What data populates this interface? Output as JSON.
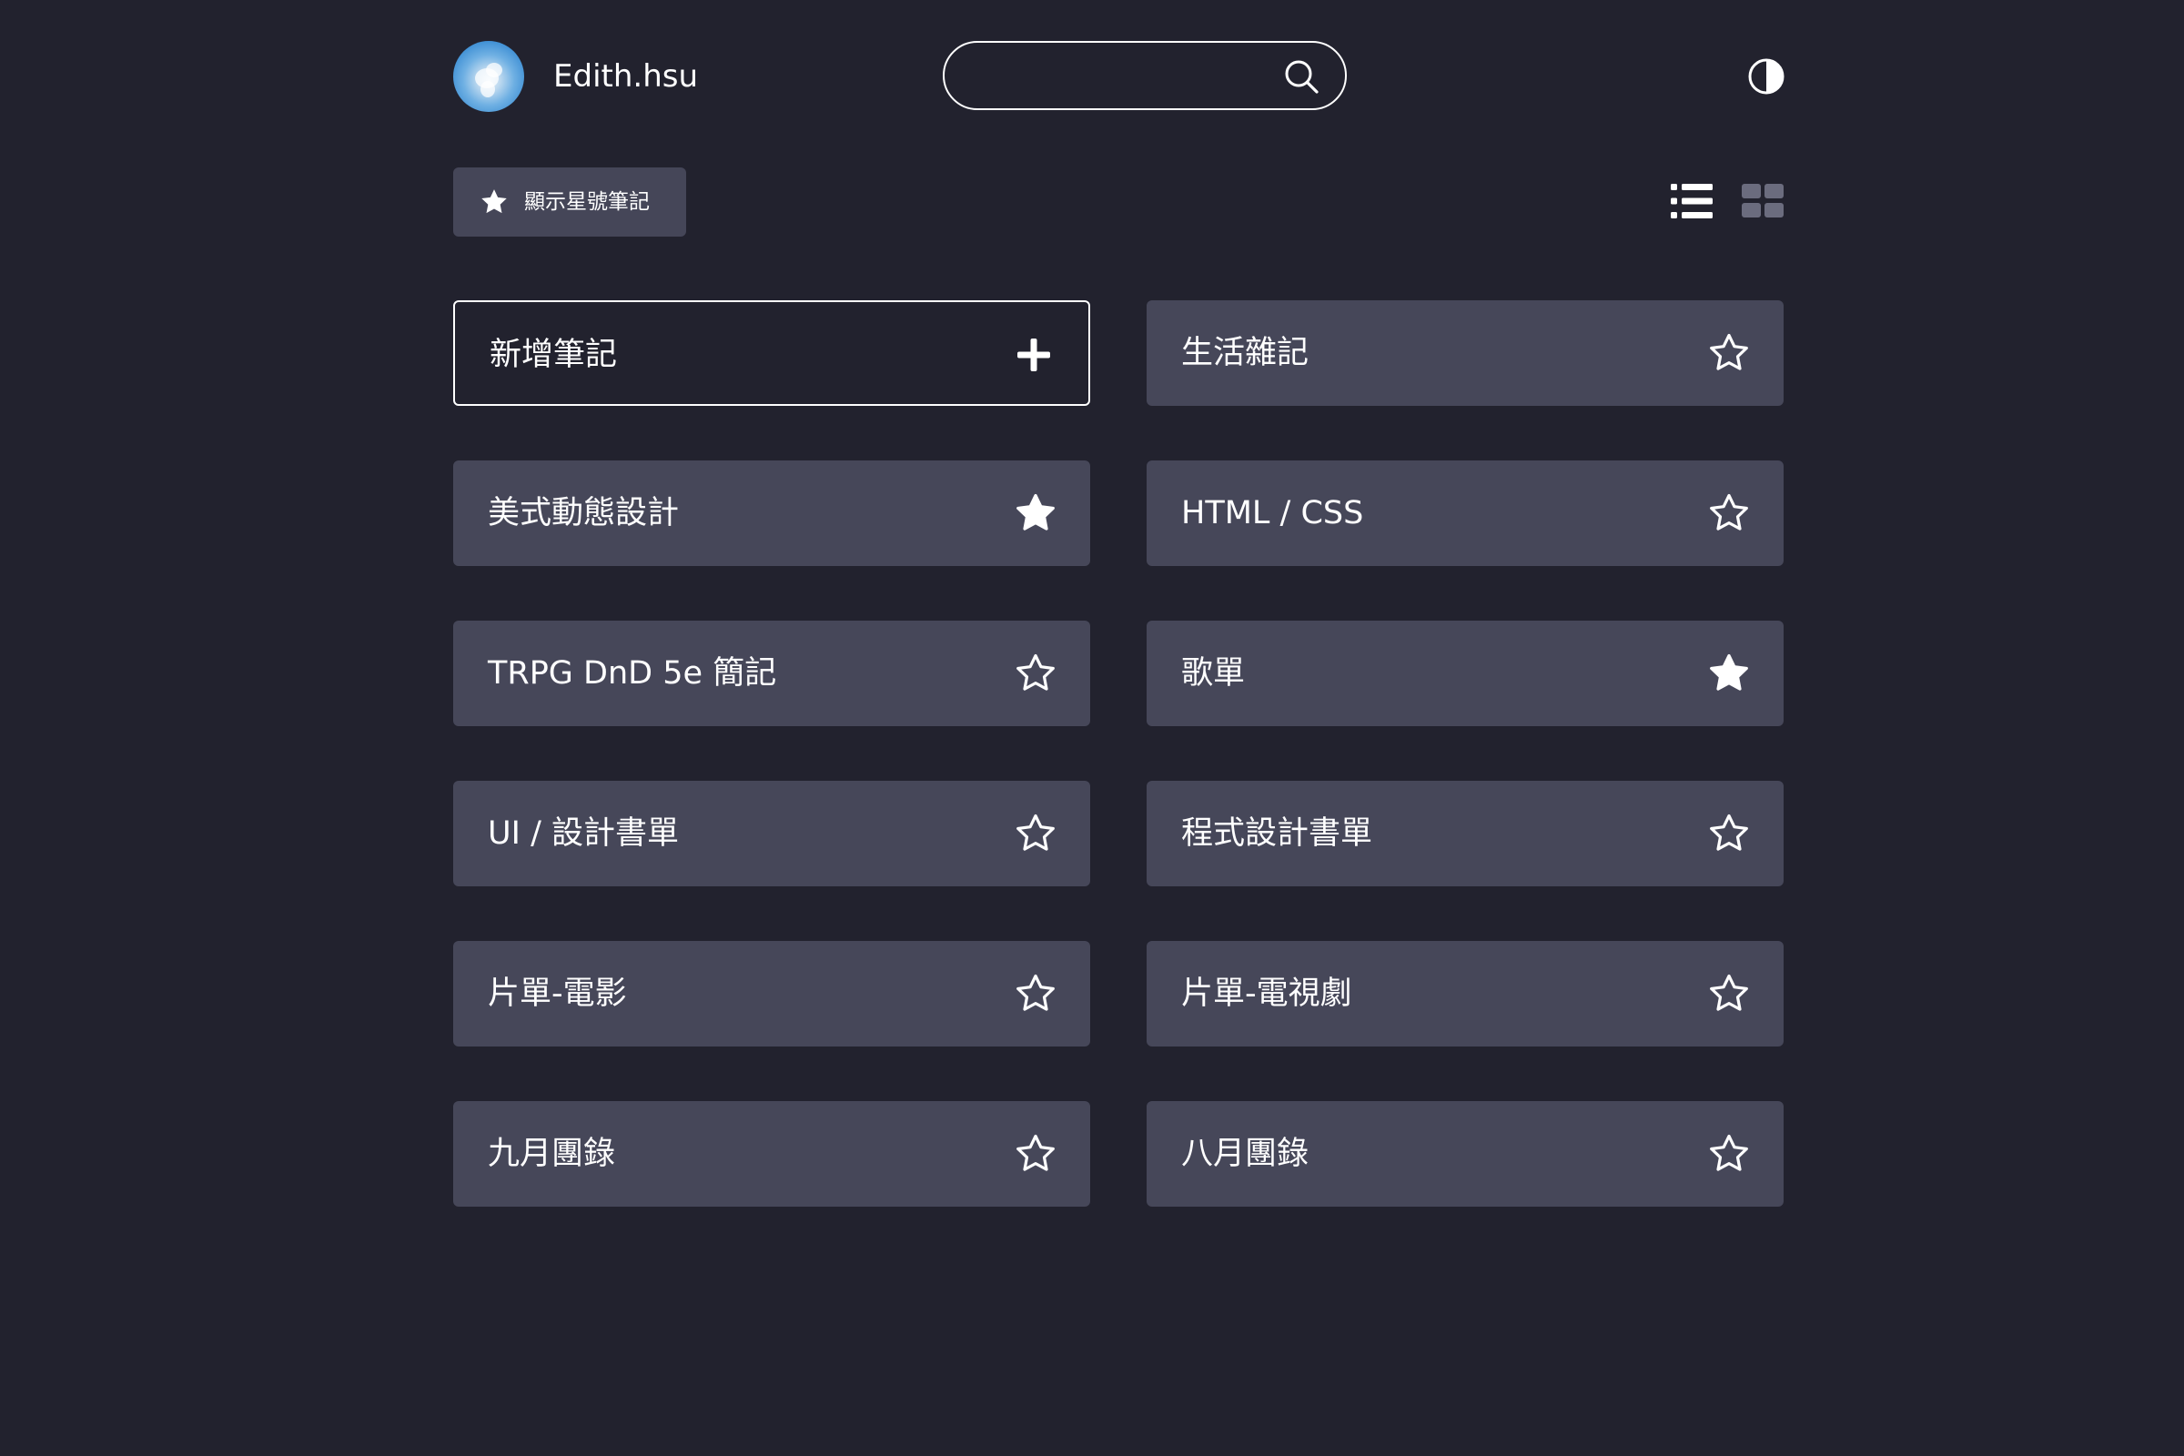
{
  "header": {
    "username": "Edith.hsu",
    "search_placeholder": "",
    "search_value": ""
  },
  "toolbar": {
    "starred_label": "顯示星號筆記",
    "active_view": "list"
  },
  "notes": {
    "add_label": "新增筆記",
    "items": [
      {
        "title": "生活雜記",
        "starred": false
      },
      {
        "title": "美式動態設計",
        "starred": true
      },
      {
        "title": "HTML / CSS",
        "starred": false
      },
      {
        "title": "TRPG DnD 5e 簡記",
        "starred": false
      },
      {
        "title": "歌單",
        "starred": true
      },
      {
        "title": "UI / 設計書單",
        "starred": false
      },
      {
        "title": "程式設計書單",
        "starred": false
      },
      {
        "title": "片單-電影",
        "starred": false
      },
      {
        "title": "片單-電視劇",
        "starred": false
      },
      {
        "title": "九月團錄",
        "starred": false
      },
      {
        "title": "八月團錄",
        "starred": false
      }
    ]
  },
  "colors": {
    "background": "#22222e",
    "card": "#464759",
    "button": "#454658",
    "text": "#ffffff",
    "inactive_icon": "#6b6c7e"
  }
}
